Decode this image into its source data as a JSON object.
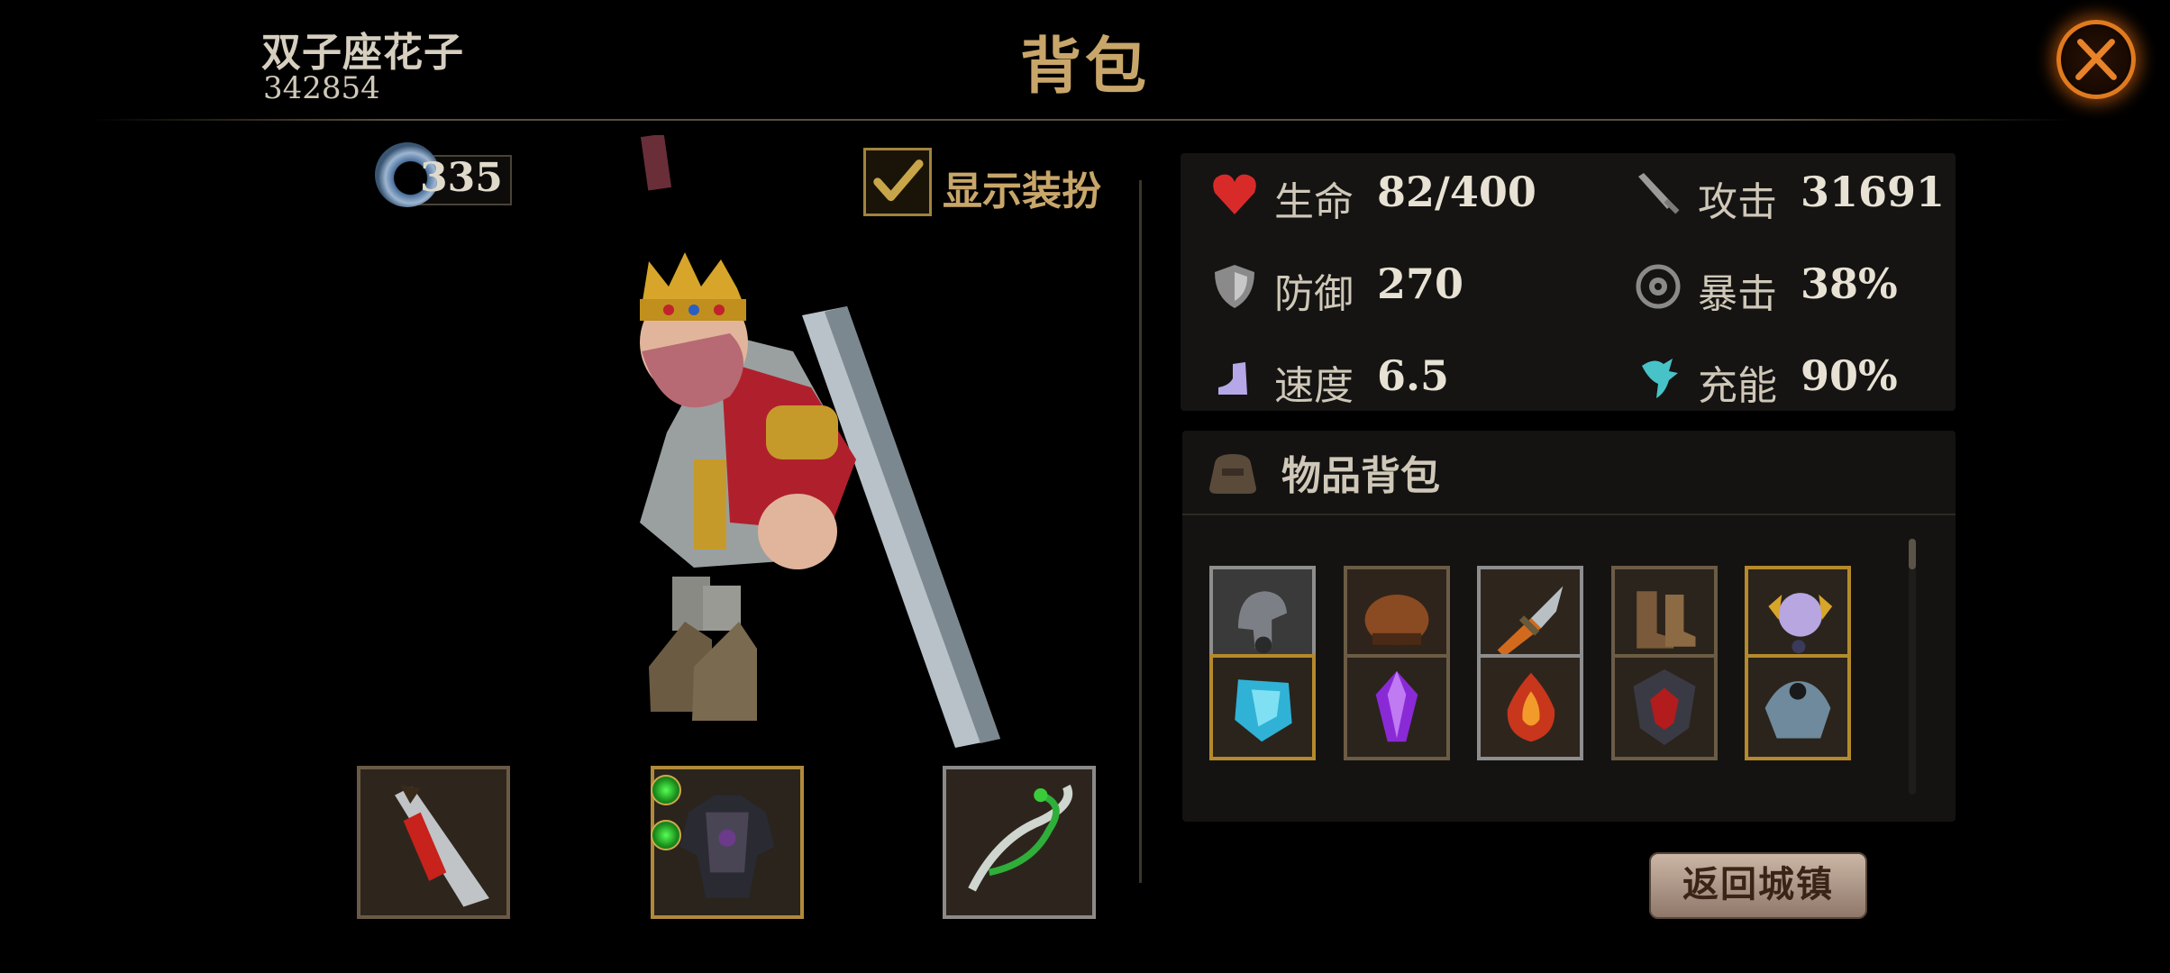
{
  "player": {
    "name": "双子座花子",
    "id": "342854"
  },
  "title": "背包",
  "currency": {
    "icon": "ring-icon",
    "value": "335"
  },
  "show_costume": {
    "label": "显示装扮",
    "checked": true
  },
  "stats": [
    {
      "key": "hp",
      "icon": "heart-icon",
      "label": "生命",
      "value": "82/400",
      "color": "#d92a2a"
    },
    {
      "key": "attack",
      "icon": "sword-icon",
      "label": "攻击",
      "value": "31691",
      "color": "#9a9a9a"
    },
    {
      "key": "defense",
      "icon": "shield-icon",
      "label": "防御",
      "value": "270",
      "color": "#9a9a9a"
    },
    {
      "key": "crit",
      "icon": "crit-icon",
      "label": "暴击",
      "value": "38%",
      "color": "#9a9a9a"
    },
    {
      "key": "speed",
      "icon": "boot-icon",
      "label": "速度",
      "value": "6.5",
      "color": "#b6a8e8"
    },
    {
      "key": "energy",
      "icon": "energy-icon",
      "label": "充能",
      "value": "90%",
      "color": "#47c3c8"
    }
  ],
  "inventory": {
    "title": "物品背包",
    "items": [
      {
        "icon": "helmet-icon",
        "quality": "silver"
      },
      {
        "icon": "leather-cap-icon",
        "quality": "bronze"
      },
      {
        "icon": "dagger-icon",
        "quality": "silver"
      },
      {
        "icon": "boots-icon",
        "quality": "bronze"
      },
      {
        "icon": "orb-amulet-icon",
        "quality": "gold"
      },
      {
        "icon": "blue-crystal-icon",
        "quality": "gold"
      },
      {
        "icon": "purple-gem-icon",
        "quality": "bronze"
      },
      {
        "icon": "fire-gem-icon",
        "quality": "silver"
      },
      {
        "icon": "demon-shield-icon",
        "quality": "bronze"
      },
      {
        "icon": "shoulder-armor-icon",
        "quality": "gold"
      }
    ]
  },
  "equipment": [
    {
      "slot": "weapon",
      "icon": "greatsword-icon"
    },
    {
      "slot": "armor",
      "icon": "dark-armor-icon",
      "gems": 2
    },
    {
      "slot": "accessory",
      "icon": "serpent-bow-icon"
    }
  ],
  "return_button": "返回城镇"
}
